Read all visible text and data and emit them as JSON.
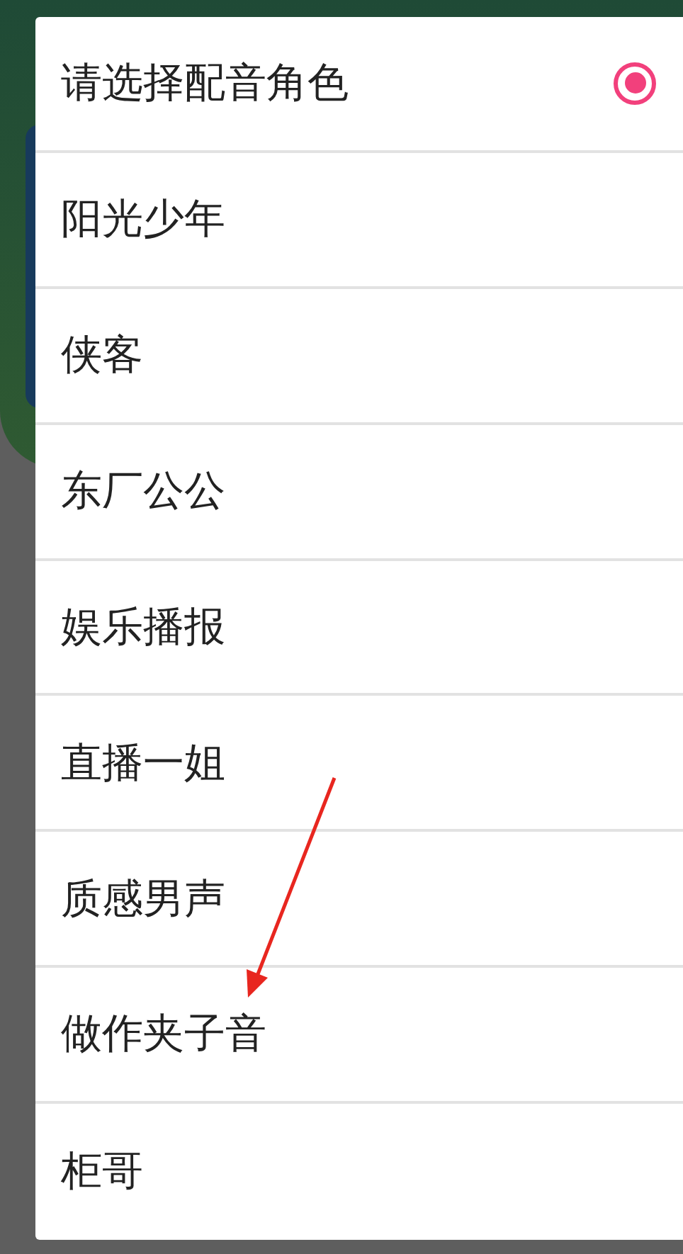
{
  "dialog": {
    "items": [
      {
        "label": "请选择配音角色",
        "selected": true
      },
      {
        "label": "阳光少年",
        "selected": false
      },
      {
        "label": "侠客",
        "selected": false
      },
      {
        "label": "东厂公公",
        "selected": false
      },
      {
        "label": "娱乐播报",
        "selected": false
      },
      {
        "label": "直播一姐",
        "selected": false
      },
      {
        "label": "质感男声",
        "selected": false
      },
      {
        "label": "做作夹子音",
        "selected": false
      },
      {
        "label": "柜哥",
        "selected": false
      }
    ]
  },
  "annotations": [
    {
      "kind": "arrow",
      "color": "#e8261f"
    }
  ]
}
